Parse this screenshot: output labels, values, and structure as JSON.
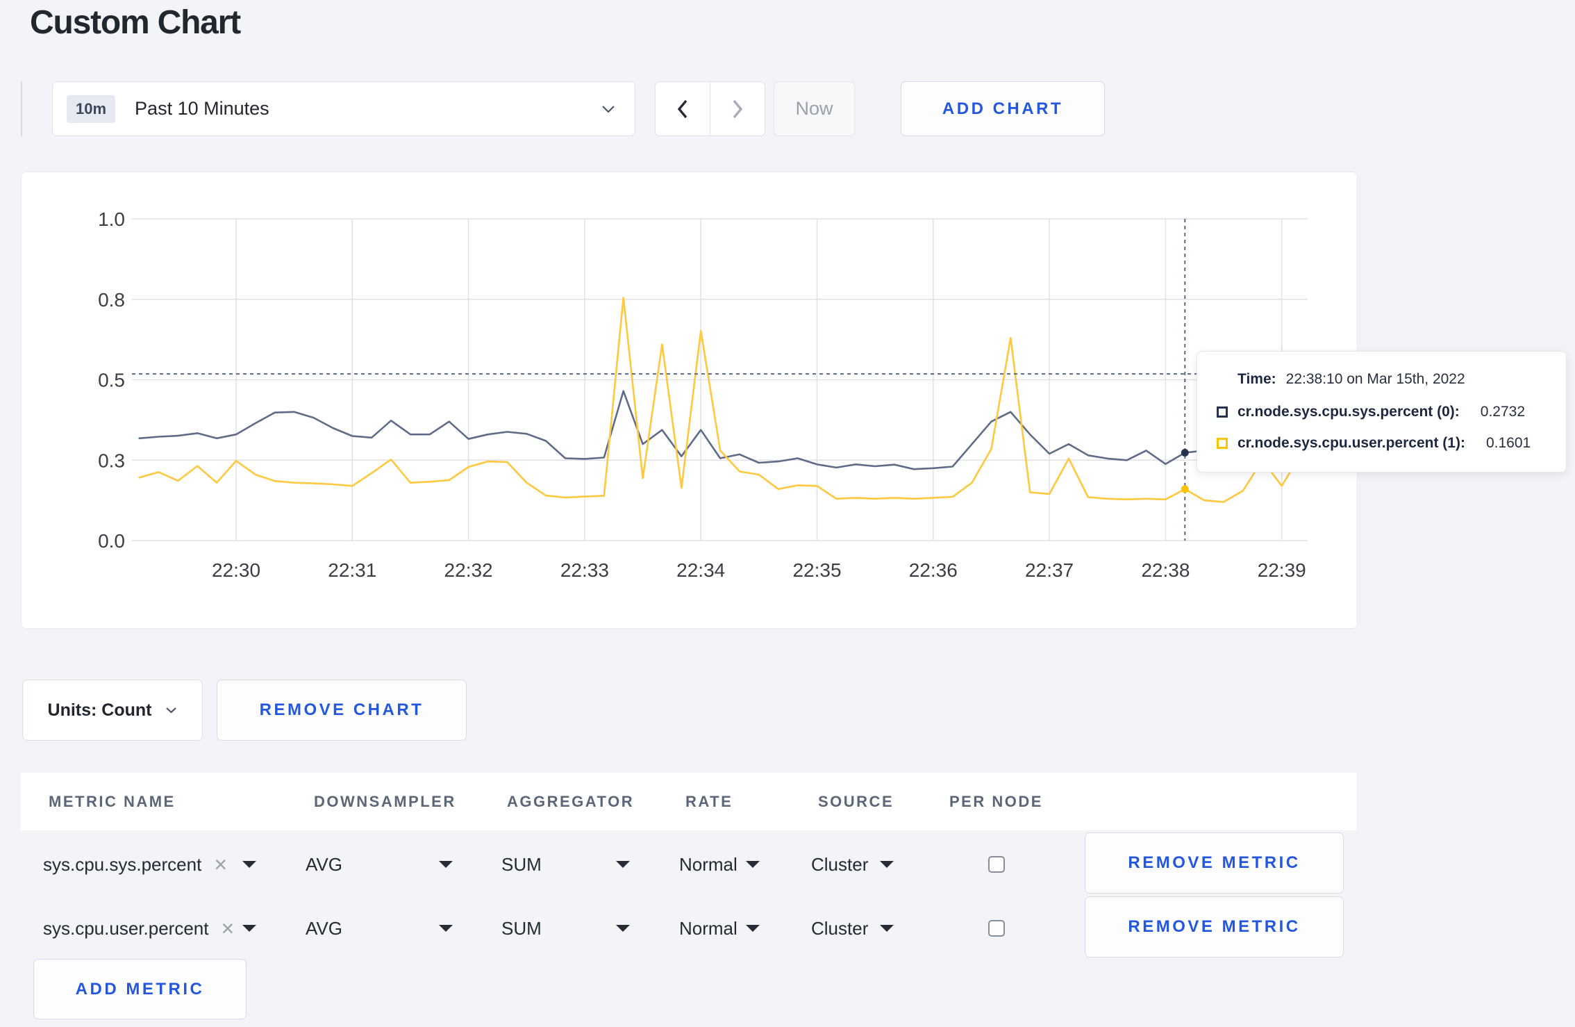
{
  "title": "Custom Chart",
  "toolbar": {
    "range_badge": "10m",
    "range_label": "Past 10 Minutes",
    "now_label": "Now",
    "add_chart_label": "ADD CHART"
  },
  "chart_actions": {
    "units_label": "Units: Count",
    "remove_chart_label": "REMOVE CHART"
  },
  "chart_data": {
    "type": "line",
    "x_start": "22:29:10",
    "x_interval_seconds": 10,
    "x_tick_labels": [
      "22:30",
      "22:31",
      "22:32",
      "22:33",
      "22:34",
      "22:35",
      "22:36",
      "22:37",
      "22:38",
      "22:39"
    ],
    "y_tick_labels": [
      "0.0",
      "0.3",
      "0.5",
      "0.8",
      "1.0"
    ],
    "y_tick_values": [
      0,
      0.25,
      0.5,
      0.75,
      1.0
    ],
    "ylim": [
      0,
      1
    ],
    "grid": true,
    "series": [
      {
        "name": "cr.node.sys.cpu.sys.percent (0)",
        "color": "#5f6c87",
        "swatch": "#233350",
        "values": [
          0.318,
          0.323,
          0.326,
          0.334,
          0.318,
          0.33,
          0.365,
          0.398,
          0.4,
          0.382,
          0.35,
          0.325,
          0.32,
          0.373,
          0.33,
          0.33,
          0.37,
          0.316,
          0.33,
          0.338,
          0.332,
          0.31,
          0.256,
          0.254,
          0.258,
          0.465,
          0.3,
          0.344,
          0.262,
          0.344,
          0.256,
          0.268,
          0.242,
          0.246,
          0.256,
          0.237,
          0.227,
          0.237,
          0.231,
          0.236,
          0.222,
          0.225,
          0.23,
          0.3,
          0.37,
          0.4,
          0.33,
          0.27,
          0.3,
          0.265,
          0.255,
          0.25,
          0.28,
          0.238,
          0.2732,
          0.28,
          0.29,
          0.285,
          0.29,
          0.295,
          0.3
        ]
      },
      {
        "name": "cr.node.sys.cpu.user.percent (1)",
        "color": "#ffc83d",
        "swatch": "#ffc400",
        "values": [
          0.196,
          0.213,
          0.186,
          0.232,
          0.18,
          0.248,
          0.205,
          0.185,
          0.18,
          0.178,
          0.175,
          0.17,
          0.21,
          0.252,
          0.18,
          0.183,
          0.188,
          0.229,
          0.246,
          0.244,
          0.18,
          0.14,
          0.134,
          0.137,
          0.139,
          0.755,
          0.194,
          0.61,
          0.164,
          0.652,
          0.28,
          0.215,
          0.205,
          0.16,
          0.172,
          0.17,
          0.13,
          0.133,
          0.13,
          0.133,
          0.13,
          0.133,
          0.136,
          0.18,
          0.285,
          0.63,
          0.15,
          0.145,
          0.255,
          0.135,
          0.13,
          0.128,
          0.13,
          0.128,
          0.1601,
          0.125,
          0.12,
          0.155,
          0.25,
          0.17,
          0.27
        ]
      }
    ],
    "crosshair": {
      "index": 54,
      "hline_value": 0.518
    }
  },
  "tooltip": {
    "time_label": "Time:",
    "time_value": "22:38:10 on Mar 15th, 2022",
    "rows": [
      {
        "label": "cr.node.sys.cpu.sys.percent (0):",
        "value": "0.2732"
      },
      {
        "label": "cr.node.sys.cpu.user.percent (1):",
        "value": "0.1601"
      }
    ]
  },
  "metrics_table": {
    "headers": [
      "METRIC NAME",
      "DOWNSAMPLER",
      "AGGREGATOR",
      "RATE",
      "SOURCE",
      "PER NODE"
    ],
    "rows": [
      {
        "metric": "sys.cpu.sys.percent",
        "downsampler": "AVG",
        "aggregator": "SUM",
        "rate": "Normal",
        "source": "Cluster",
        "per_node": false,
        "remove_label": "REMOVE METRIC"
      },
      {
        "metric": "sys.cpu.user.percent",
        "downsampler": "AVG",
        "aggregator": "SUM",
        "rate": "Normal",
        "source": "Cluster",
        "per_node": false,
        "remove_label": "REMOVE METRIC"
      }
    ],
    "add_metric_label": "ADD METRIC"
  }
}
